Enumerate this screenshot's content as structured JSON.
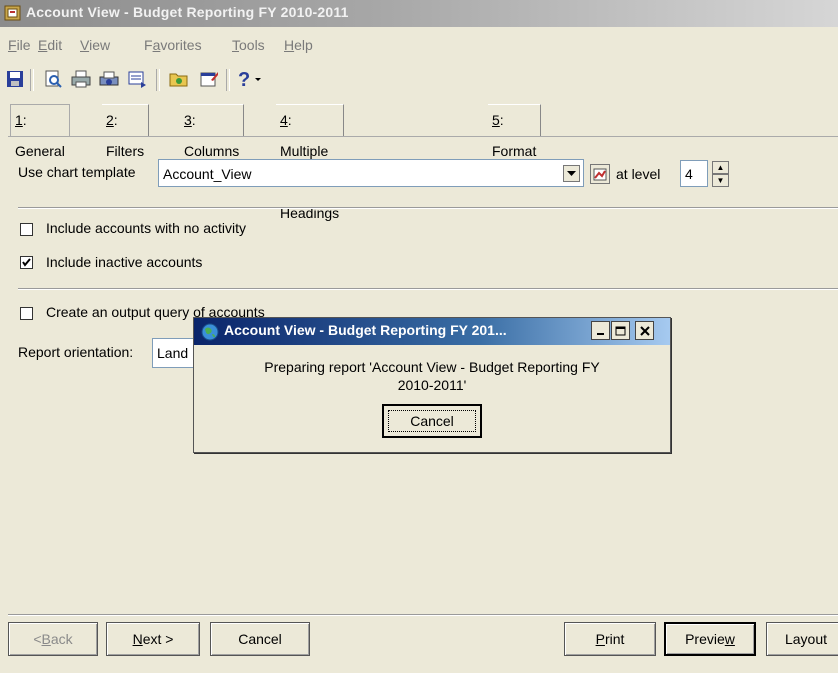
{
  "window": {
    "title": "Account View - Budget Reporting  FY 2010-2011"
  },
  "menu": [
    {
      "pre": "",
      "ul": "F",
      "post": "ile"
    },
    {
      "pre": "",
      "ul": "E",
      "post": "dit"
    },
    {
      "pre": "",
      "ul": "V",
      "post": "iew"
    },
    {
      "pre": "F",
      "ul": "a",
      "post": "vorites"
    },
    {
      "pre": "",
      "ul": "T",
      "post": "ools"
    },
    {
      "pre": "",
      "ul": "H",
      "post": "elp"
    }
  ],
  "toolbar_icons": [
    "save-icon",
    "print-preview-icon",
    "print-icon",
    "print-setup-icon",
    "export-icon",
    "open-folder-icon",
    "properties-icon",
    "help-icon"
  ],
  "tabs": [
    {
      "ul": "1",
      "post": ": General"
    },
    {
      "ul": "2",
      "post": ": Filters"
    },
    {
      "ul": "3",
      "post": ": Columns"
    },
    {
      "ul": "4",
      "post": ": Multiple Column Headings"
    },
    {
      "ul": "5",
      "post": ": Format"
    }
  ],
  "general": {
    "chart_template_label": "Use chart template",
    "chart_template_value": "Account_View",
    "at_level_label": "at level",
    "level_value": "4",
    "include_no_activity_label": "Include accounts with no activity",
    "include_no_activity_checked": false,
    "include_inactive_label": "Include inactive accounts",
    "include_inactive_checked": true,
    "create_output_query_label": "Create an output query of accounts",
    "create_output_query_checked": false,
    "report_orientation_label": "Report orientation:",
    "report_orientation_value": "Land"
  },
  "buttons": {
    "back": {
      "ul": "B",
      "pre": "< ",
      "post": "ack"
    },
    "next": {
      "ul": "N",
      "pre": "",
      "post": "ext >"
    },
    "cancel": "Cancel",
    "print": {
      "ul": "P",
      "post": "rint"
    },
    "preview": {
      "pre": "Previe",
      "ul": "w",
      "post": ""
    },
    "layout": "Layout"
  },
  "dialog": {
    "title": "Account View - Budget Reporting  FY 201...",
    "message_line1": "Preparing report 'Account View - Budget Reporting  FY",
    "message_line2": "2010-2011'",
    "cancel_label": "Cancel"
  },
  "colors": {
    "dialog_title_start": "#0a246a",
    "dialog_title_end": "#a6caf0",
    "window_bg": "#ece9d8"
  }
}
